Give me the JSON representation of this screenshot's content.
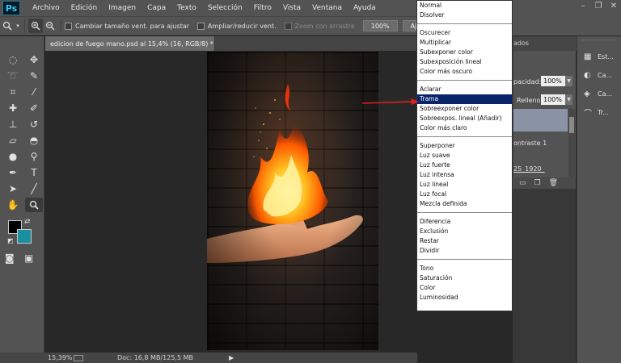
{
  "app": {
    "logo": "Ps"
  },
  "menu": [
    "Archivo",
    "Edición",
    "Imagen",
    "Capa",
    "Texto",
    "Selección",
    "Filtro",
    "Vista",
    "Ventana",
    "Ayuda"
  ],
  "window_controls": {
    "minimize": "–",
    "restore": "❐",
    "close": "✕"
  },
  "options_bar": {
    "resize_windows_label": "Cambiar tamaño vent. para ajustar",
    "zoom_all_label": "Ampliar/reducir vent.",
    "scrubby_zoom_label": "Zoom con arrastre",
    "zoom_100_label": "100%",
    "fit_screen_label": "Ajustar pa"
  },
  "document": {
    "tab_title": "edicion de fuego mano.psd al 15,4% (16, RGB/8) *",
    "tab_close": "×"
  },
  "status_bar": {
    "zoom": "15,39%",
    "doc_info": "Doc: 16,8 MB/125,5 MB",
    "arrow": "▶"
  },
  "blend_modes": {
    "groups": [
      [
        "Normal",
        "Disolver"
      ],
      [
        "Oscurecer",
        "Multiplicar",
        "Subexponer color",
        "Subexposición lineal",
        "Color más oscuro"
      ],
      [
        "Aclarar",
        "Trama",
        "Sobreexponer color",
        "Sobreexpos. lineal (Añadir)",
        "Color más claro"
      ],
      [
        "Superponer",
        "Luz suave",
        "Luz fuerte",
        "Luz intensa",
        "Luz lineal",
        "Luz focal",
        "Mezcla definida"
      ],
      [
        "Diferencia",
        "Exclusión",
        "Restar",
        "Dividir"
      ],
      [
        "Tono",
        "Saturación",
        "Color",
        "Luminosidad"
      ]
    ],
    "selected": "Trama"
  },
  "layers_panel": {
    "tab_fragment": "ados",
    "opacity_label": "pacidad:",
    "opacity_value": "100%",
    "fill_label": "Relleno:",
    "fill_value": "100%",
    "layer_contrast": "ontraste 1",
    "layer_image": "25_1920_"
  },
  "dock": {
    "items": [
      {
        "icon": "styles-icon",
        "label": "Est..."
      },
      {
        "icon": "adjustments-icon",
        "label": "Ca..."
      },
      {
        "icon": "layers-icon",
        "label": "Ca..."
      },
      {
        "icon": "paths-icon",
        "label": "Tr..."
      }
    ]
  },
  "colors": {
    "foreground": "#000000",
    "background": "#1a8fa0",
    "selection": "#0a246a",
    "annotation_arrow": "#e02020"
  }
}
